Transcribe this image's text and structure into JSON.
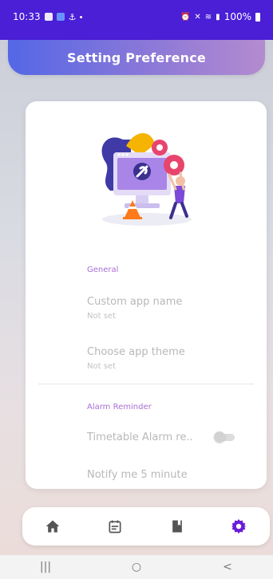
{
  "status_bar": {
    "time": "10:33",
    "battery": "100%"
  },
  "header": {
    "title": "Setting Preference"
  },
  "sections": {
    "general": {
      "label": "General",
      "items": [
        {
          "title": "Custom app name",
          "summary": "Not set"
        },
        {
          "title": "Choose app theme",
          "summary": "Not set"
        }
      ]
    },
    "alarm": {
      "label": "Alarm Reminder",
      "items": [
        {
          "title": "Timetable Alarm re..",
          "toggle_on": false
        },
        {
          "title": "Notify me 5 minute"
        }
      ]
    }
  },
  "bottom_nav": {
    "items": [
      {
        "icon": "home-icon",
        "active": false
      },
      {
        "icon": "calendar-icon",
        "active": false
      },
      {
        "icon": "book-icon",
        "active": false
      },
      {
        "icon": "gear-icon",
        "active": true
      }
    ],
    "active_color": "#6a1bd8",
    "inactive_color": "#555555"
  },
  "system_nav": {
    "recents": "|||",
    "home": "○",
    "back": "<"
  },
  "colors": {
    "status_bar": "#4a1fd6",
    "accent": "#a96fd3"
  }
}
